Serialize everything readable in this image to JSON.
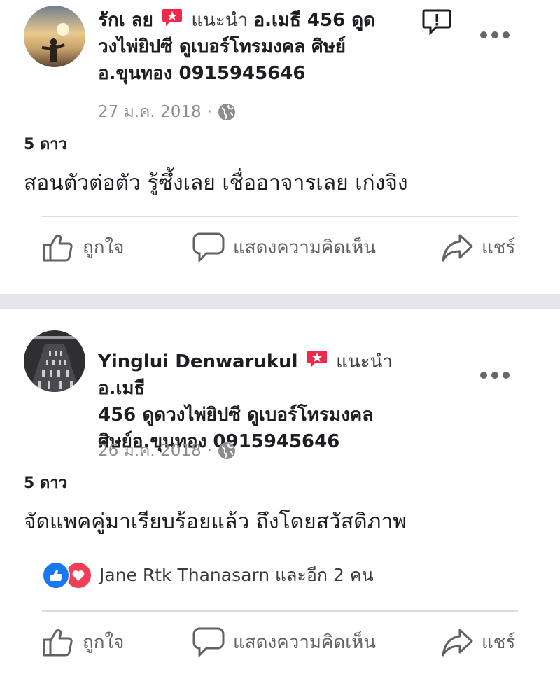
{
  "posts": [
    {
      "author": "รักเ ลย",
      "recommend_word": "แนะนำ",
      "title_line1": "อ.เมธี 456 ดูด",
      "title_line2": "วงไพ่ยิปซี ดูเบอร์โทรมงคล ศิษย์",
      "title_line3": "อ.ขุนทอง 0915945646",
      "date": "27 ม.ค. 2018",
      "rating": "5 ดาว",
      "body": "สอนตัวต่อตัว รู้ซึ้งเลย เชื่ออาจารเลย เก่งจิง"
    },
    {
      "author": "Yinglui Denwarukul",
      "recommend_word": "แนะนำ",
      "title_line1": "อ.เมธี",
      "title_line2": "456 ดูดวงไพ่ยิปซี ดูเบอร์โทรมงคล",
      "title_line3": "ศิษย์อ.ขุนทอง 0915945646",
      "date": "26 ม.ค. 2018",
      "rating": "5 ดาว",
      "body": "จัดแพคคู่มาเรียบร้อยแล้ว ถึงโดยสวัสดิภาพ",
      "reactions_text": "Jane Rtk Thanasarn และอีก 2 คน"
    }
  ],
  "actions": {
    "like": "ถูกใจ",
    "comment": "แสดงความคิดเห็น",
    "share": "แชร์"
  },
  "colors": {
    "badge": "#f02849",
    "like_blue": "#1877f2",
    "love_red": "#f33e58",
    "meta_gray": "#8a8d91",
    "divider": "#e4e6eb"
  },
  "icons": [
    "recommend-badge-icon",
    "globe-icon",
    "more-options-icon",
    "report-icon",
    "thumbs-up-icon",
    "comment-bubble-icon",
    "share-arrow-icon",
    "like-reaction-icon",
    "love-reaction-icon"
  ]
}
